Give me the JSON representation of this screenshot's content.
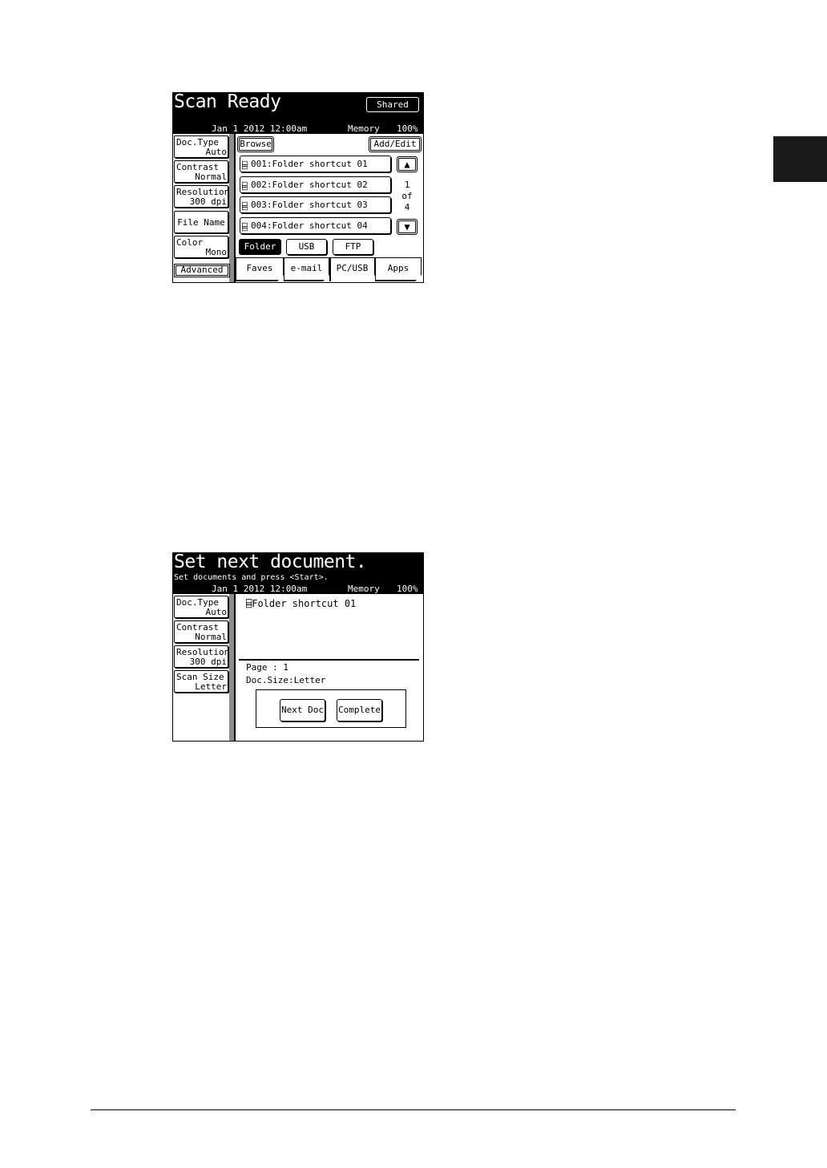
{
  "screen1": {
    "title": "Scan Ready",
    "shared_label": "Shared",
    "date": "Jan  1 2012 12:00am",
    "memory_label": "Memory",
    "memory_value": "100%",
    "side": {
      "doc_type": {
        "label": "Doc.Type",
        "value": "Auto"
      },
      "contrast": {
        "label": "Contrast",
        "value": "Normal"
      },
      "resolution": {
        "label": "Resolution",
        "value": "300 dpi"
      },
      "file_name": {
        "label": "File Name"
      },
      "color": {
        "label": "Color",
        "value": "Mono"
      },
      "advanced": "Advanced"
    },
    "browse_label": "Browse",
    "add_edit_label": "Add/Edit",
    "folders": [
      {
        "label": "001:Folder shortcut 01"
      },
      {
        "label": "002:Folder shortcut 02"
      },
      {
        "label": "003:Folder shortcut 03"
      },
      {
        "label": "004:Folder shortcut 04"
      }
    ],
    "page_indicator": {
      "current": "1",
      "of": "of",
      "total": "4"
    },
    "up_arrow": "▲",
    "down_arrow": "▼",
    "destinations": {
      "folder": "Folder",
      "usb": "USB",
      "ftp": "FTP"
    },
    "tabs": {
      "faves": "Faves",
      "email": "e-mail",
      "pcusb": "PC/USB",
      "apps": "Apps"
    }
  },
  "screen2": {
    "title": "Set next document.",
    "subtitle": "Set documents and press <Start>.",
    "date": "Jan  1 2012 12:00am",
    "memory_label": "Memory",
    "memory_value": "100%",
    "side": {
      "doc_type": {
        "label": "Doc.Type",
        "value": "Auto"
      },
      "contrast": {
        "label": "Contrast",
        "value": "Normal"
      },
      "resolution": {
        "label": "Resolution",
        "value": "300 dpi"
      },
      "scan_size": {
        "label": "Scan Size",
        "value": "Letter"
      }
    },
    "folder_name": "Folder shortcut 01",
    "page_line": "Page :  1",
    "doc_size_line": "Doc.Size:Letter",
    "next_doc_label": "Next Doc",
    "complete_label": "Complete"
  },
  "icons": {
    "folder": "folder-icon"
  }
}
